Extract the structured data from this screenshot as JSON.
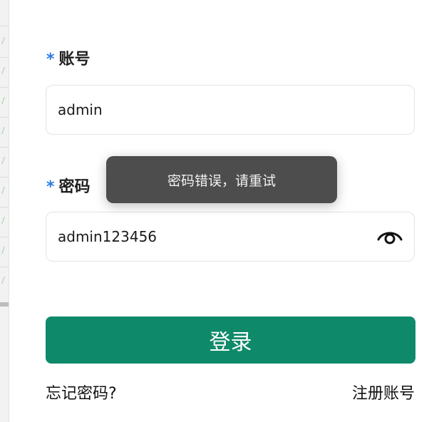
{
  "login_form": {
    "account": {
      "required_mark": "*",
      "label": "账号",
      "value": "admin"
    },
    "password": {
      "required_mark": "*",
      "label": "密码",
      "value": "admin123456",
      "toggle_icon": "eye-icon"
    },
    "submit_label": "登录",
    "forgot_link": "忘记密码?",
    "register_link": "注册账号"
  },
  "toast": {
    "message": "密码错误，请重试"
  },
  "colors": {
    "accent": "#0e8a6a",
    "required": "#2c7be5",
    "toast_bg": "#4d4d4d"
  }
}
